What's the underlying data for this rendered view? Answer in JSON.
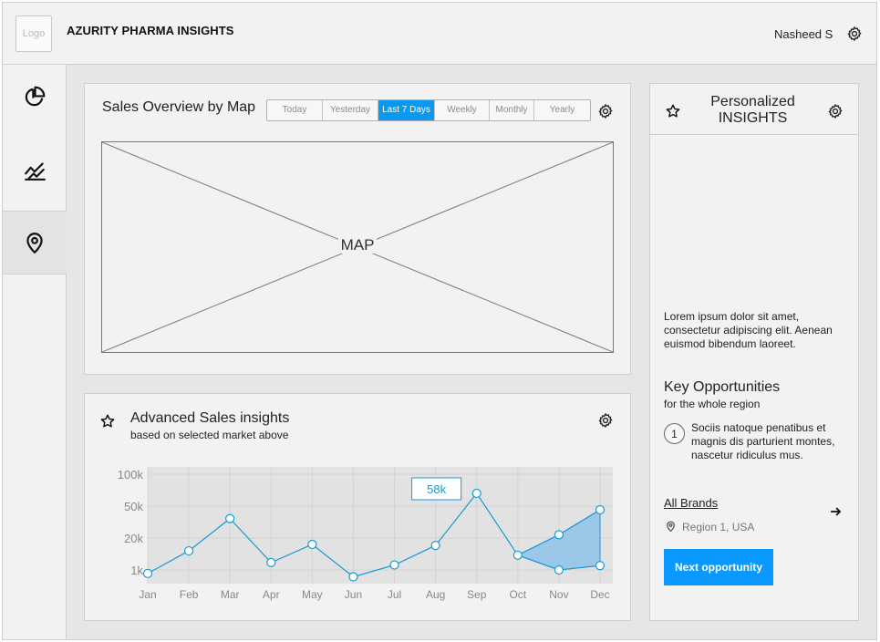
{
  "header": {
    "logo_text": "Logo",
    "app_title": "AZURITY PHARMA INSIGHTS",
    "user_name": "Nasheed S",
    "settings_icon": "gear-icon"
  },
  "sidebar": {
    "items": [
      {
        "icon": "pie-chart-icon",
        "active": false
      },
      {
        "icon": "trend-chart-icon",
        "active": false
      },
      {
        "icon": "map-pin-icon",
        "active": true
      }
    ]
  },
  "map_panel": {
    "title": "Sales Overview by Map",
    "ranges": [
      "Today",
      "Yesterday",
      "Last 7 Days",
      "Weekly",
      "Monthly",
      "Yearly"
    ],
    "selected_range": "Last 7 Days",
    "map_placeholder": "MAP"
  },
  "advanced_panel": {
    "title": "Advanced Sales insights",
    "subtitle": "based on selected market above"
  },
  "insights_panel": {
    "title_line1": "Personalized",
    "title_line2": "INSIGHTS",
    "lorem": "Lorem ipsum dolor sit amet, consectetur adipiscing elit. Aenean euismod bibendum laoreet.",
    "key_opps_title": "Key Opportunities",
    "key_opps_sub": "for the whole region",
    "opp_number": "1",
    "opp_text": "Sociis natoque penatibus et magnis dis parturient montes, nascetur ridiculus mus.",
    "all_brands": "All Brands",
    "region": "Region 1, USA",
    "next_button": "Next opportunity"
  },
  "colors": {
    "accent": "#0a99ff",
    "line": "#1a9ad6",
    "area_fill": "#8ec3ea"
  },
  "chart_data": {
    "type": "line",
    "title": "",
    "xlabel": "",
    "ylabel": "",
    "y_scale": "log",
    "yticks": [
      "1k",
      "20k",
      "50k",
      "100k"
    ],
    "categories": [
      "Jan",
      "Feb",
      "Mar",
      "Apr",
      "May",
      "Jun",
      "Jul",
      "Aug",
      "Sep",
      "Oct",
      "Nov",
      "Dec"
    ],
    "series": [
      {
        "values": [
          0.7,
          6,
          35,
          2,
          11,
          0.5,
          1.6,
          10,
          66,
          4,
          22,
          45
        ]
      }
    ],
    "lower_band": {
      "categories": [
        "Nov",
        "Dec"
      ],
      "values": [
        1,
        1.5
      ]
    },
    "highlight_label": "58k",
    "grid": true
  }
}
